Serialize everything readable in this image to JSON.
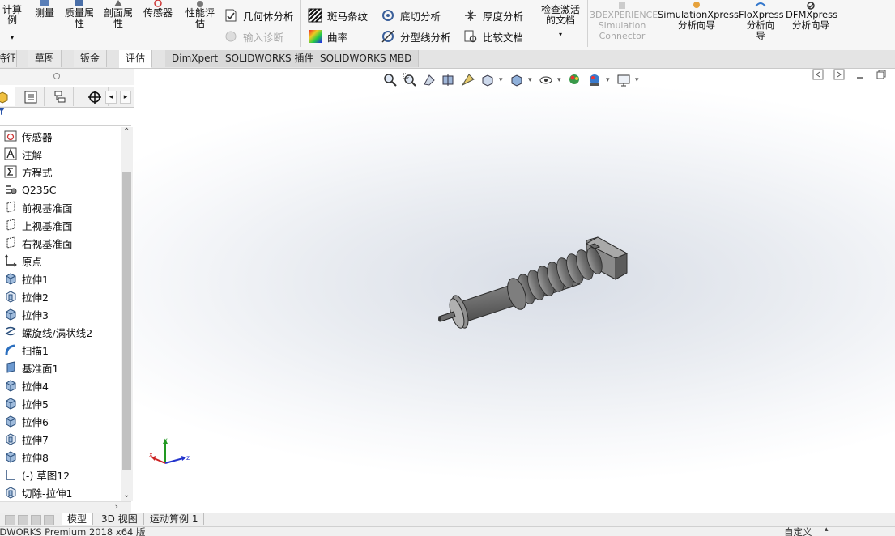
{
  "ribbon": {
    "buttons_large": [
      {
        "label": "计算\n例",
        "name": "mass-calc-button"
      },
      {
        "label": "测量",
        "name": "measure-button"
      },
      {
        "label": "质量属\n性",
        "name": "mass-properties-button"
      },
      {
        "label": "剖面属\n性",
        "name": "section-properties-button"
      },
      {
        "label": "传感器",
        "name": "sensor-button"
      },
      {
        "label": "性能评\n估",
        "name": "performance-eval-button"
      }
    ],
    "geometry_analysis": "几何体分析",
    "import_diagnostics": "输入诊断",
    "zebra_stripes": "斑马条纹",
    "curvature": "曲率",
    "undercut_analysis": "底切分析",
    "parting_line_analysis": "分型线分析",
    "thickness_analysis": "厚度分析",
    "compare_documents": "比较文档",
    "check_active_doc": "检查激活\n的文档",
    "connector_label": "3DEXPERIENCE\nSimulation\nConnector",
    "simxpress": "SimulationXpress\n分析向导",
    "floxpress": "FloXpress\n分析向\n导",
    "dfmxpress": "DFMXpress\n分析向导"
  },
  "command_tabs": [
    {
      "label": "特征",
      "name": "tab-features"
    },
    {
      "label": "草图",
      "name": "tab-sketch"
    },
    {
      "label": "钣金",
      "name": "tab-sheet-metal"
    },
    {
      "label": "评估",
      "name": "tab-evaluate"
    },
    {
      "label": "DimXpert",
      "name": "tab-dimxpert"
    },
    {
      "label": "SOLIDWORKS 插件",
      "name": "tab-solidworks-addins"
    },
    {
      "label": "SOLIDWORKS MBD",
      "name": "tab-solidworks-mbd"
    }
  ],
  "feature_tree": [
    {
      "label": "传感器",
      "icon": "sensor-icon"
    },
    {
      "label": "注解",
      "icon": "annotation-icon"
    },
    {
      "label": "方程式",
      "icon": "equation-icon"
    },
    {
      "label": "Q235C",
      "icon": "material-icon"
    },
    {
      "label": "前视基准面",
      "icon": "plane-icon"
    },
    {
      "label": "上视基准面",
      "icon": "plane-icon"
    },
    {
      "label": "右视基准面",
      "icon": "plane-icon"
    },
    {
      "label": "原点",
      "icon": "origin-icon"
    },
    {
      "label": "拉伸1",
      "icon": "boss-extrude-icon"
    },
    {
      "label": "拉伸2",
      "icon": "cut-extrude-icon"
    },
    {
      "label": "拉伸3",
      "icon": "boss-extrude-icon"
    },
    {
      "label": "螺旋线/涡状线2",
      "icon": "helix-icon"
    },
    {
      "label": "扫描1",
      "icon": "sweep-icon"
    },
    {
      "label": "基准面1",
      "icon": "plane-solid-icon"
    },
    {
      "label": "拉伸4",
      "icon": "boss-extrude-icon"
    },
    {
      "label": "拉伸5",
      "icon": "boss-extrude-icon"
    },
    {
      "label": "拉伸6",
      "icon": "boss-extrude-icon"
    },
    {
      "label": "拉伸7",
      "icon": "cut-extrude-icon"
    },
    {
      "label": "拉伸8",
      "icon": "boss-extrude-icon"
    },
    {
      "label": "(-) 草图12",
      "icon": "sketch-icon"
    },
    {
      "label": "切除-拉伸1",
      "icon": "cut-extrude-icon"
    }
  ],
  "bottom_tabs": [
    {
      "label": "模型",
      "name": "tab-model"
    },
    {
      "label": "3D 视图",
      "name": "tab-3d-views"
    },
    {
      "label": "运动算例 1",
      "name": "tab-motion-study-1"
    }
  ],
  "status": {
    "product": "IDWORKS Premium 2018 x64 版",
    "units": "自定义"
  },
  "triad": {
    "x": "x",
    "y": "y",
    "z": "z"
  },
  "colors": {
    "accent_blue": "#1f5fbf",
    "model_grey": "#8a8a8a",
    "triad_red": "#cc2222",
    "triad_green": "#229922",
    "triad_blue": "#2233cc"
  }
}
